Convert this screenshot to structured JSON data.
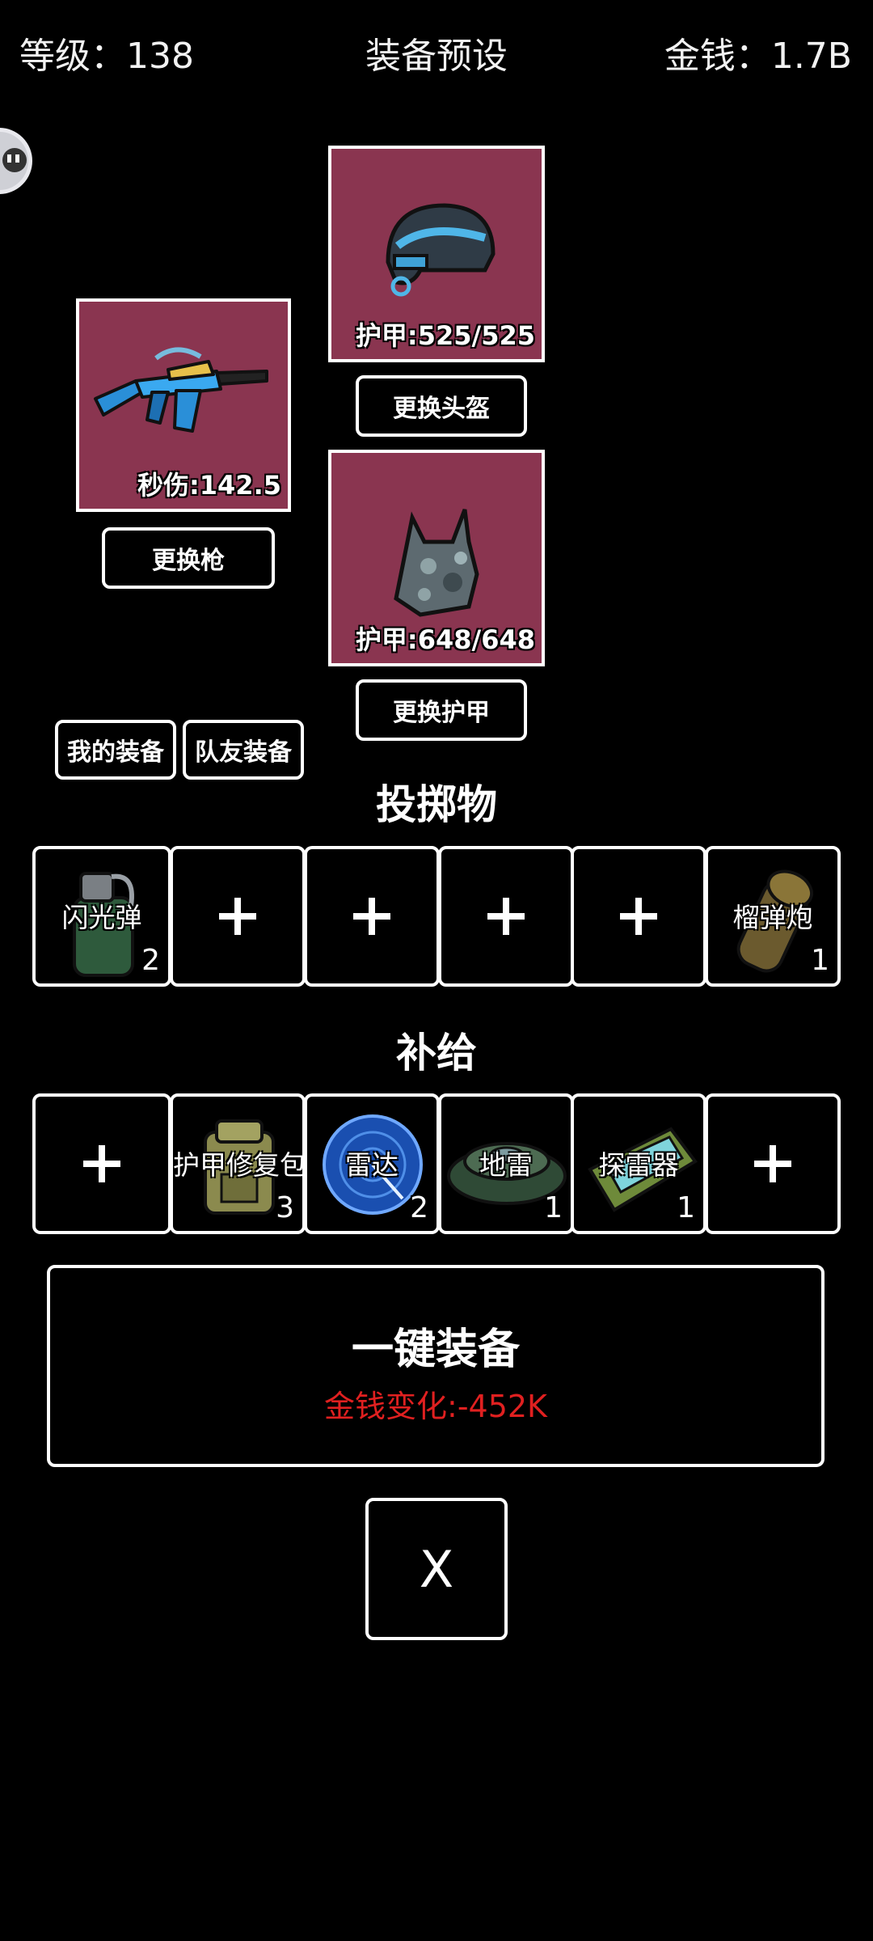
{
  "header": {
    "level_text": "等级：138",
    "title": "装备预设",
    "money_text": "金钱：1.7B"
  },
  "gun": {
    "stat": "秒伤:142.5",
    "change_label": "更换枪",
    "icon": "rifle-icon"
  },
  "helmet": {
    "stat": "护甲:525/525",
    "change_label": "更换头盔",
    "icon": "helmet-icon"
  },
  "armor": {
    "stat": "护甲:648/648",
    "change_label": "更换护甲",
    "icon": "vest-icon"
  },
  "tabs": {
    "mine": "我的装备",
    "teammate": "队友装备"
  },
  "throwables": {
    "title": "投掷物",
    "slots": [
      {
        "label": "闪光弹",
        "count": "2",
        "icon": "flashbang-icon"
      },
      {
        "empty": true
      },
      {
        "empty": true
      },
      {
        "empty": true
      },
      {
        "empty": true
      },
      {
        "label": "榴弹炮",
        "count": "1",
        "icon": "grenade-launcher-icon"
      }
    ]
  },
  "supplies": {
    "title": "补给",
    "slots": [
      {
        "empty": true
      },
      {
        "label": "护甲修复包",
        "count": "3",
        "icon": "armor-repair-kit-icon"
      },
      {
        "label": "雷达",
        "count": "2",
        "icon": "radar-icon"
      },
      {
        "label": "地雷",
        "count": "1",
        "icon": "landmine-icon"
      },
      {
        "label": "探雷器",
        "count": "1",
        "icon": "mine-detector-icon"
      },
      {
        "empty": true
      }
    ]
  },
  "equip_all": {
    "label": "一键装备",
    "money_change": "金钱变化:-452K",
    "money_change_color": "#e02020"
  },
  "close": {
    "label": "X"
  }
}
